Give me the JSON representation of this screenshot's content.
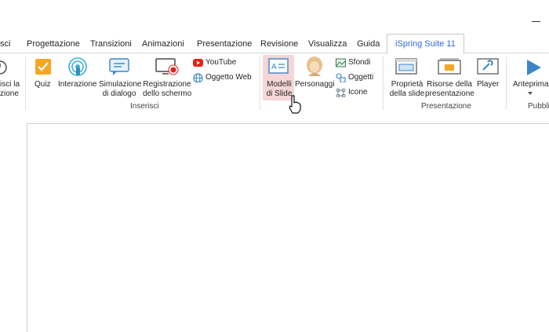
{
  "window": {
    "minimize_icon": "minimize-icon"
  },
  "tabs": [
    {
      "label": "sci",
      "active": false
    },
    {
      "label": "Progettazione",
      "active": false
    },
    {
      "label": "Transizioni",
      "active": false
    },
    {
      "label": "Animazioni",
      "active": false
    },
    {
      "label": "Presentazione",
      "active": false
    },
    {
      "label": "Revisione",
      "active": false
    },
    {
      "label": "Visualizza",
      "active": false
    },
    {
      "label": "Guida",
      "active": false
    },
    {
      "label": "iSpring Suite 11",
      "active": true
    }
  ],
  "ribbon": {
    "partial_first": {
      "line1": "isci la",
      "line2": "zione"
    },
    "inserisci_group": {
      "label": "Inserisci",
      "quiz": "Quiz",
      "interazione": "Interazione",
      "simulazione": {
        "line1": "Simulazione",
        "line2": "di dialogo"
      },
      "registrazione": {
        "line1": "Registrazione",
        "line2": "dello schermo"
      },
      "youtube": "YouTube",
      "oggetto_web": "Oggetto Web"
    },
    "middle_group": {
      "modelli": {
        "line1": "Modelli",
        "line2": "di Slide"
      },
      "personaggi": "Personaggi",
      "sfondi": "Sfondi",
      "oggetti": "Oggetti",
      "icone": "Icone"
    },
    "presentazione_group": {
      "label": "Presentazione",
      "proprieta": {
        "line1": "Proprietà",
        "line2": "della slide"
      },
      "risorse": {
        "line1": "Risorse della",
        "line2": "presentazione"
      },
      "player": "Player"
    },
    "publish_group": {
      "anteprima": "Anteprima",
      "label_partial": "Pubblic"
    }
  },
  "colors": {
    "accent_tab": "#2e6bd8",
    "hover": "#f6d6d6",
    "youtube_red": "#e62117"
  }
}
